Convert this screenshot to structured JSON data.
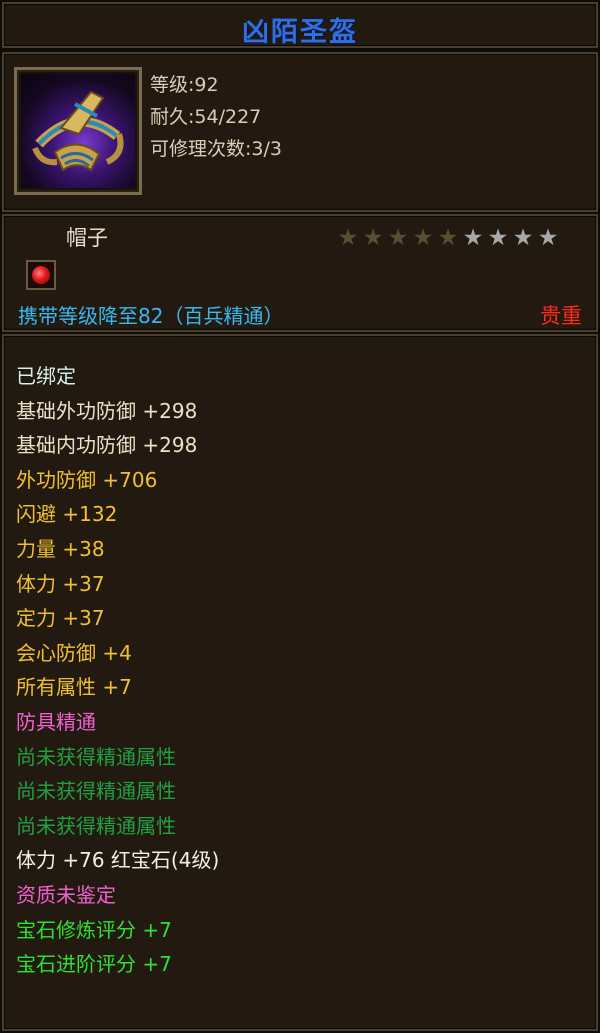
{
  "item": {
    "name": "凶陌圣盔",
    "icon": "helmet-icon",
    "level_label": "等级:92",
    "durability_label": "耐久:54/227",
    "repair_label": "可修理次数:3/3",
    "type": "帽子",
    "stars": {
      "filled": 5,
      "total": 9
    },
    "carry_text": "携带等级降至82（百兵精通）",
    "rarity": "贵重"
  },
  "attributes": [
    {
      "text": "已绑定",
      "color": "#d8f0e8"
    },
    {
      "text": "基础外功防御 +298",
      "color": "#ece2c8"
    },
    {
      "text": "基础内功防御 +298",
      "color": "#ece2c8"
    },
    {
      "text": "外功防御 +706",
      "color": "#f0c030"
    },
    {
      "text": "闪避 +132",
      "color": "#f0c030"
    },
    {
      "text": "力量 +38",
      "color": "#f0c030"
    },
    {
      "text": "体力 +37",
      "color": "#f0c030"
    },
    {
      "text": "定力 +37",
      "color": "#f0c030"
    },
    {
      "text": "会心防御 +4",
      "color": "#f0c030"
    },
    {
      "text": "所有属性 +7",
      "color": "#f0c030"
    },
    {
      "text": "防具精通",
      "color": "#f060d0"
    },
    {
      "text": "尚未获得精通属性",
      "color": "#20a040"
    },
    {
      "text": "尚未获得精通属性",
      "color": "#20a040"
    },
    {
      "text": "尚未获得精通属性",
      "color": "#20a040"
    },
    {
      "text": "体力 +76 红宝石(4级)",
      "color": "#f0f0e8"
    },
    {
      "text": "资质未鉴定",
      "color": "#f060d0"
    },
    {
      "text": "宝石修炼评分 +7",
      "color": "#30e030"
    },
    {
      "text": "宝石进阶评分 +7",
      "color": "#30e030"
    }
  ],
  "colors": {
    "title": "#2f6fe6",
    "carry": "#38b8f0",
    "rarity": "#ff2a1a",
    "background": "#221a10"
  }
}
